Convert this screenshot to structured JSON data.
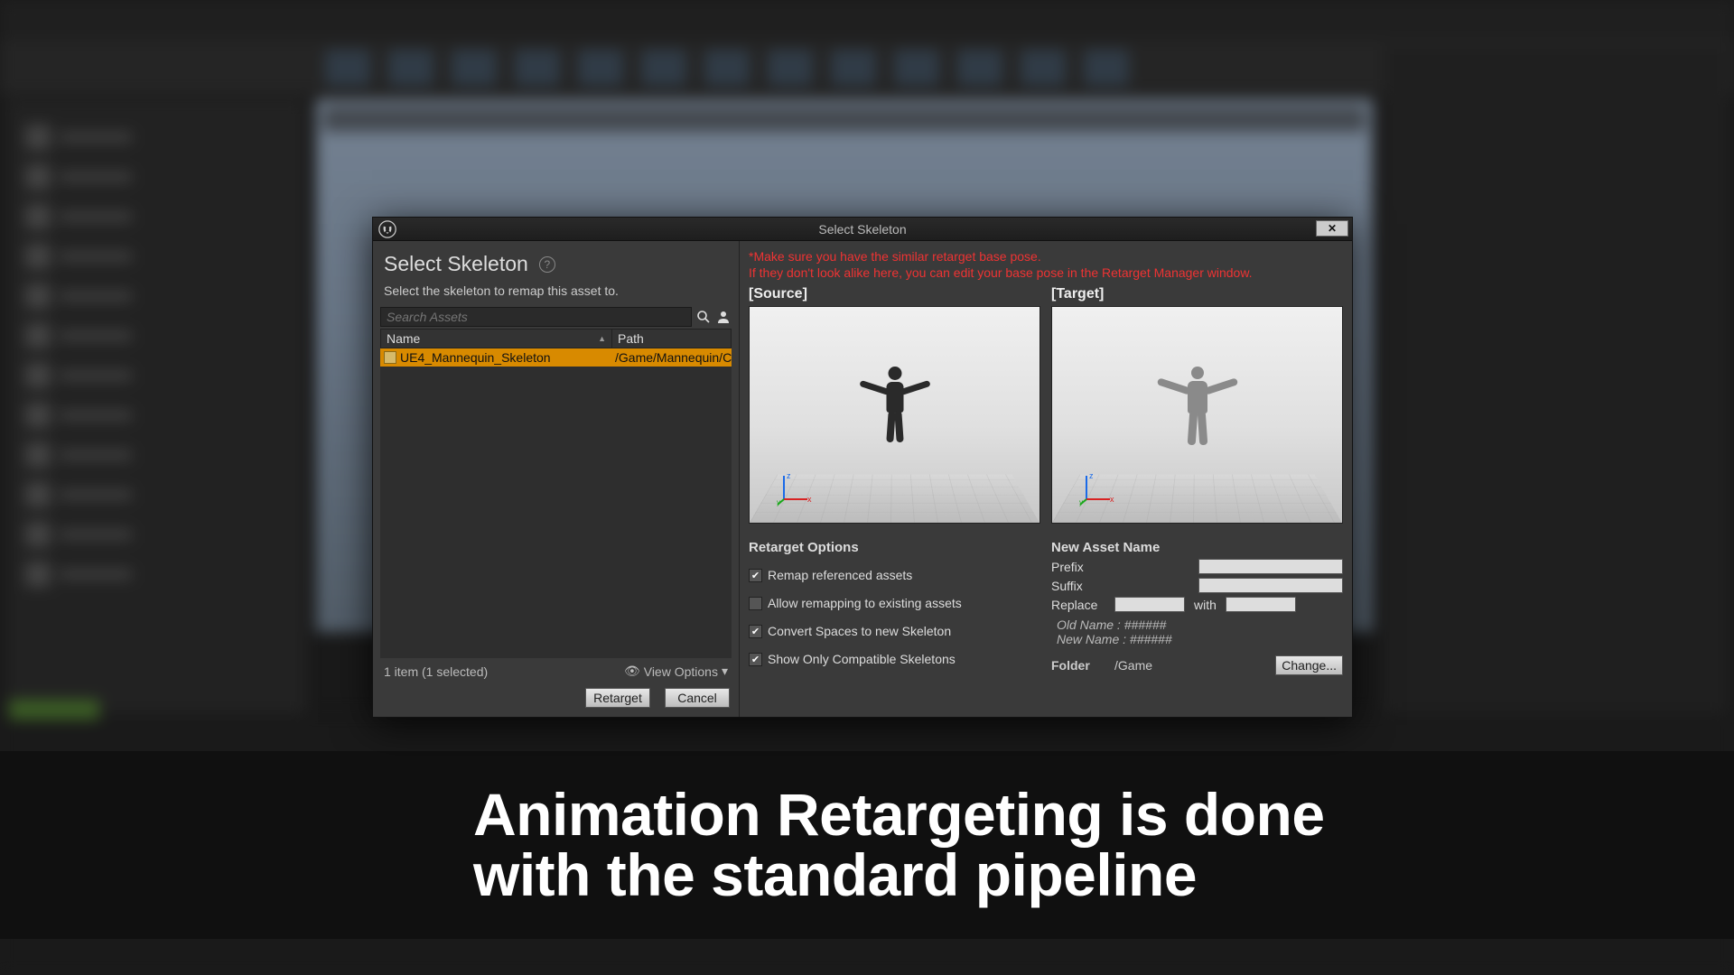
{
  "dialog": {
    "window_title": "Select Skeleton",
    "heading": "Select Skeleton",
    "subtitle": "Select the skeleton to remap this asset to.",
    "search_placeholder": "Search Assets",
    "columns": {
      "name": "Name",
      "path": "Path"
    },
    "rows": [
      {
        "name": "UE4_Mannequin_Skeleton",
        "path": "/Game/Mannequin/Char"
      }
    ],
    "footer_count": "1 item (1 selected)",
    "view_options": "View Options",
    "retarget_btn": "Retarget",
    "cancel_btn": "Cancel"
  },
  "warning": {
    "line1": "*Make sure you have the similar retarget base pose.",
    "line2": "If they don't look alike here, you can edit your base pose in the Retarget Manager window."
  },
  "preview": {
    "source_label": "[Source]",
    "target_label": "[Target]"
  },
  "options": {
    "heading": "Retarget Options",
    "remap": "Remap referenced assets",
    "allow_existing": "Allow remapping to existing assets",
    "convert_spaces": "Convert Spaces to new Skeleton",
    "compat_only": "Show Only Compatible Skeletons"
  },
  "naming": {
    "heading": "New Asset Name",
    "prefix_label": "Prefix",
    "suffix_label": "Suffix",
    "replace_label": "Replace",
    "with_label": "with",
    "old_name": "Old Name : ######",
    "new_name": "New Name : ######",
    "folder_label": "Folder",
    "folder_value": "/Game",
    "change_btn": "Change..."
  },
  "caption": "Animation Retargeting is done\nwith the standard pipeline"
}
